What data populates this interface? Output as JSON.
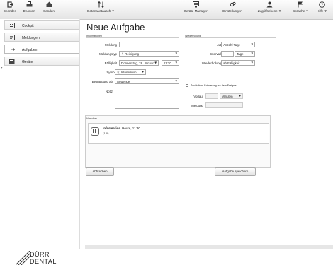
{
  "toolbar": {
    "items": [
      {
        "label": "Beenden",
        "icon": "exit-icon"
      },
      {
        "label": "Drucken",
        "icon": "printer-icon"
      },
      {
        "label": "Senden",
        "icon": "send-icon"
      },
      {
        "label": "Datenaustausch",
        "icon": "data-exchange-icon"
      },
      {
        "label": "Geräte Manager",
        "icon": "device-manager-icon"
      },
      {
        "label": "Einstellungen",
        "icon": "settings-icon"
      },
      {
        "label": "Zugriffsebene",
        "icon": "access-level-icon"
      },
      {
        "label": "Sprache",
        "icon": "language-icon"
      },
      {
        "label": "Hilfe",
        "icon": "help-icon"
      }
    ]
  },
  "sidebar": {
    "items": [
      {
        "label": "Cockpit",
        "icon": "cockpit-icon"
      },
      {
        "label": "Meldungen",
        "icon": "messages-icon"
      },
      {
        "label": "Aufgaben",
        "icon": "tasks-icon"
      },
      {
        "label": "Geräte",
        "icon": "devices-icon"
      }
    ],
    "logo_line1": "DÜRR",
    "logo_line2": "DENTAL"
  },
  "form": {
    "title": "Neue Aufgabe",
    "section_info": "Informationen",
    "section_repeat": "Wiederholung",
    "labels": {
      "meldung": "Meldung",
      "meldungstyp": "Meldungstyp",
      "faelligkeit": "Fälligkeit",
      "symbol": "Symbol",
      "bestaetigung": "Bestätigung ab",
      "notiz": "Notiz",
      "art": "Art",
      "intervall": "Intervall",
      "wiederholung": "Wiederholung",
      "zusaetzlich": "Zusätzliche Erinnerung vor dem Ereignis",
      "vorlauf": "Vorlauf",
      "meldung2": "Meldung"
    },
    "values": {
      "meldung": "",
      "meldungstyp": "Reinigung",
      "datum": "Donnerstag, 28. Januar 2",
      "zeit": "11:30",
      "symbol": "Information",
      "bestaetigung": "Anwender",
      "art": "Anzahl Tage",
      "intervall": "",
      "intervall_unit": "Tage",
      "wiederholung": "ab Fälligkeit",
      "vorlauf": "",
      "vorlauf_unit": "Minuten",
      "meldung2": ""
    }
  },
  "preview": {
    "label": "Vorschau",
    "title": "Information",
    "time": "Heute, 11:30",
    "count": "(1-0)"
  },
  "buttons": {
    "cancel": "Abbrechen",
    "save": "Aufgabe speichern"
  }
}
